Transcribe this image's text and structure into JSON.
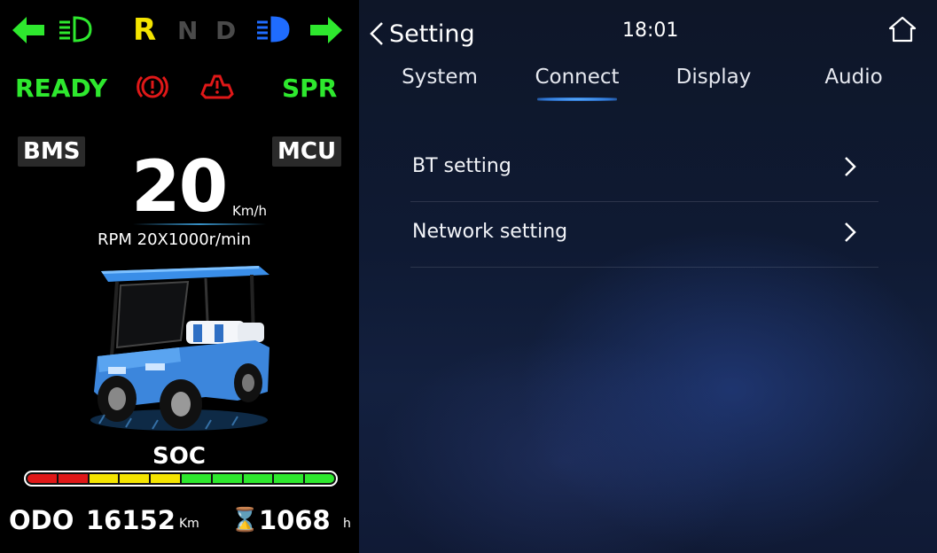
{
  "cluster": {
    "gear_r": "R",
    "gear_n": "N",
    "gear_d": "D",
    "ready": "READY",
    "spr": "SPR",
    "bms": "BMS",
    "mcu": "MCU",
    "speed": "20",
    "speed_unit": "Km/h",
    "rpm": "RPM 20X1000r/min",
    "soc_label": "SOC",
    "soc_segments": 10,
    "odo_label": "ODO",
    "odo_value": "16152",
    "odo_unit": "Km",
    "hours_value": "1068",
    "hours_unit": "h",
    "hours_icon": "⌛",
    "colors": {
      "green": "#2ee82e",
      "yellow": "#f4e400",
      "red": "#e01818",
      "blue": "#1f6cff"
    }
  },
  "header": {
    "back_label": "Setting",
    "time": "18:01"
  },
  "tabs": [
    {
      "label": "System"
    },
    {
      "label": "Connect"
    },
    {
      "label": "Display"
    },
    {
      "label": "Audio"
    }
  ],
  "active_tab": "Connect",
  "menu": [
    {
      "label": "BT setting"
    },
    {
      "label": "Network setting"
    }
  ]
}
